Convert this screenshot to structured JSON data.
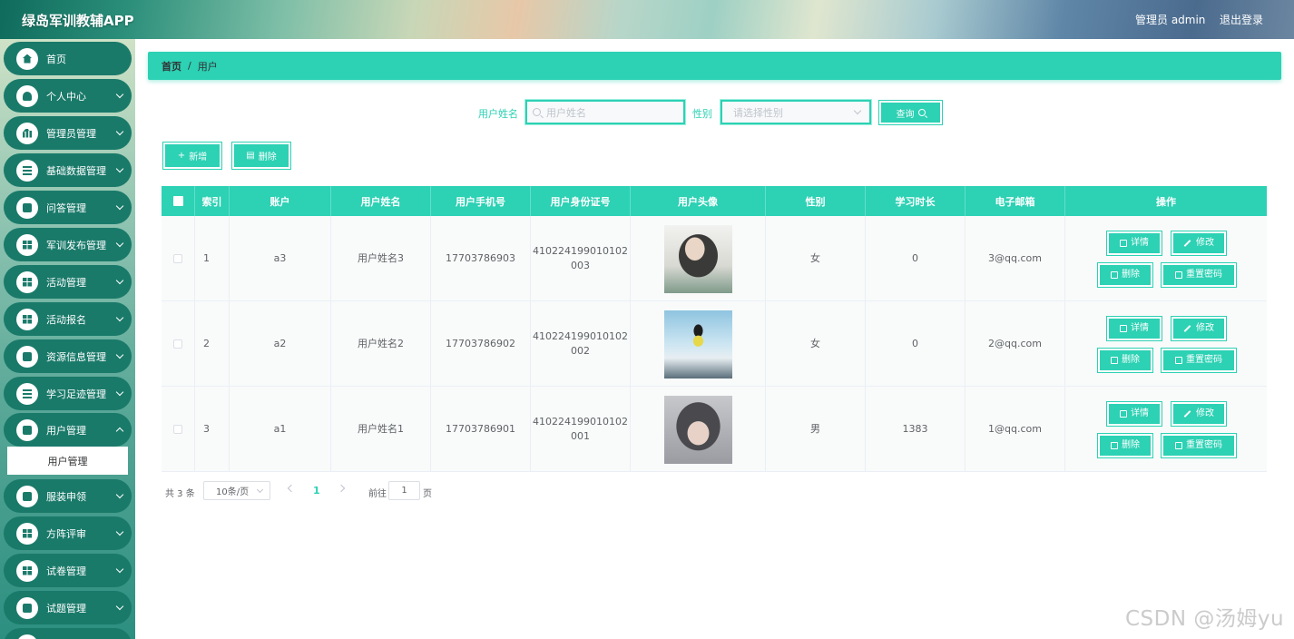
{
  "header": {
    "app_title": "绿岛军训教辅APP",
    "user_label": "管理员 admin",
    "logout_label": "退出登录"
  },
  "sidebar": {
    "items": [
      {
        "label": "首页",
        "icon": "home-icon",
        "expandable": false
      },
      {
        "label": "个人中心",
        "icon": "person-icon",
        "expandable": true
      },
      {
        "label": "管理员管理",
        "icon": "chart-icon",
        "expandable": true
      },
      {
        "label": "基础数据管理",
        "icon": "list-icon",
        "expandable": true
      },
      {
        "label": "问答管理",
        "icon": "chat-icon",
        "expandable": true
      },
      {
        "label": "军训发布管理",
        "icon": "grid-icon",
        "expandable": true
      },
      {
        "label": "活动管理",
        "icon": "grid-icon",
        "expandable": true
      },
      {
        "label": "活动报名",
        "icon": "grid-icon",
        "expandable": true
      },
      {
        "label": "资源信息管理",
        "icon": "edit-icon",
        "expandable": true
      },
      {
        "label": "学习足迹管理",
        "icon": "list-icon",
        "expandable": true
      },
      {
        "label": "用户管理",
        "icon": "chat-icon",
        "expandable": true
      },
      {
        "label": "服装申领",
        "icon": "clipboard-icon",
        "expandable": true
      },
      {
        "label": "方阵评审",
        "icon": "grid-icon",
        "expandable": true
      },
      {
        "label": "试卷管理",
        "icon": "grid-icon",
        "expandable": true
      },
      {
        "label": "试题管理",
        "icon": "bookmark-icon",
        "expandable": true
      }
    ],
    "active_submenu": "用户管理"
  },
  "breadcrumb": {
    "home": "首页",
    "separator": "/",
    "current": "用户"
  },
  "search": {
    "name_label": "用户姓名",
    "name_placeholder": "用户姓名",
    "gender_label": "性别",
    "gender_placeholder": "请选择性别",
    "query_button": "查询"
  },
  "actions": {
    "add_button": "新增",
    "delete_button": "删除"
  },
  "table": {
    "columns": [
      "索引",
      "账户",
      "用户姓名",
      "用户手机号",
      "用户身份证号",
      "用户头像",
      "性别",
      "学习时长",
      "电子邮箱",
      "操作"
    ],
    "rows": [
      {
        "index": "1",
        "account": "a3",
        "name": "用户姓名3",
        "phone": "17703786903",
        "id_line1": "410224199010102",
        "id_line2": "003",
        "gender": "女",
        "study_time": "0",
        "email": "3@qq.com"
      },
      {
        "index": "2",
        "account": "a2",
        "name": "用户姓名2",
        "phone": "17703786902",
        "id_line1": "410224199010102",
        "id_line2": "002",
        "gender": "女",
        "study_time": "0",
        "email": "2@qq.com"
      },
      {
        "index": "3",
        "account": "a1",
        "name": "用户姓名1",
        "phone": "17703786901",
        "id_line1": "410224199010102",
        "id_line2": "001",
        "gender": "男",
        "study_time": "1383",
        "email": "1@qq.com"
      }
    ],
    "row_actions": {
      "detail": "详情",
      "edit": "修改",
      "delete": "删除",
      "reset_password": "重置密码"
    }
  },
  "pagination": {
    "total_text": "共 3 条",
    "page_size": "10条/页",
    "current_page": "1",
    "goto_label": "前往",
    "goto_value": "1",
    "page_suffix": "页"
  },
  "watermark": "CSDN @汤姆yu",
  "colors": {
    "accent": "#2dd1b4",
    "sidebar_item": "#1a7a6a"
  }
}
